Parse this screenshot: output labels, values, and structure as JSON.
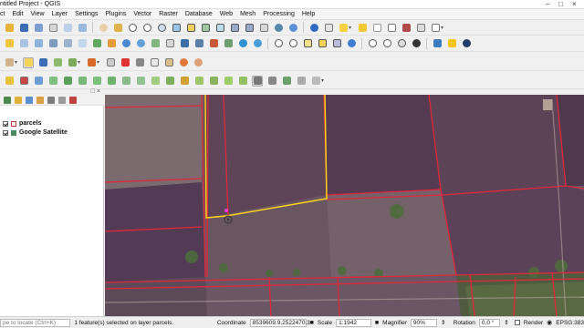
{
  "window": {
    "title": "ntitled Project - QGIS"
  },
  "menu": [
    "ct",
    "Edit",
    "View",
    "Layer",
    "Settings",
    "Plugins",
    "Vector",
    "Raster",
    "Database",
    "Web",
    "Mesh",
    "Processing",
    "Help"
  ],
  "layers_panel": {
    "layers": [
      {
        "name": "parcels",
        "checked": true,
        "icon": "polygon-layer-icon"
      },
      {
        "name": "Google Satellite",
        "checked": true,
        "icon": "raster-layer-icon"
      }
    ]
  },
  "status": {
    "locate_placeholder": "pe to locate (Ctrl+K)",
    "message": "1 feature(s) selected on layer parcels.",
    "coordinate_label": "Coordinate",
    "coordinate_value": "8539609.9,2522470.3",
    "scale_label": "Scale",
    "scale_value": "1:1942",
    "magnifier_label": "Magnifier",
    "magnifier_value": "90%",
    "rotation_label": "Rotation",
    "rotation_value": "0.0 °",
    "render_label": "Render",
    "render_checked": true,
    "crs_label": "EPSG:383"
  },
  "colors": {
    "parcel_outline": "#e0283a",
    "selected_outline": "#ffd21a",
    "map_background": "#6b5863"
  }
}
